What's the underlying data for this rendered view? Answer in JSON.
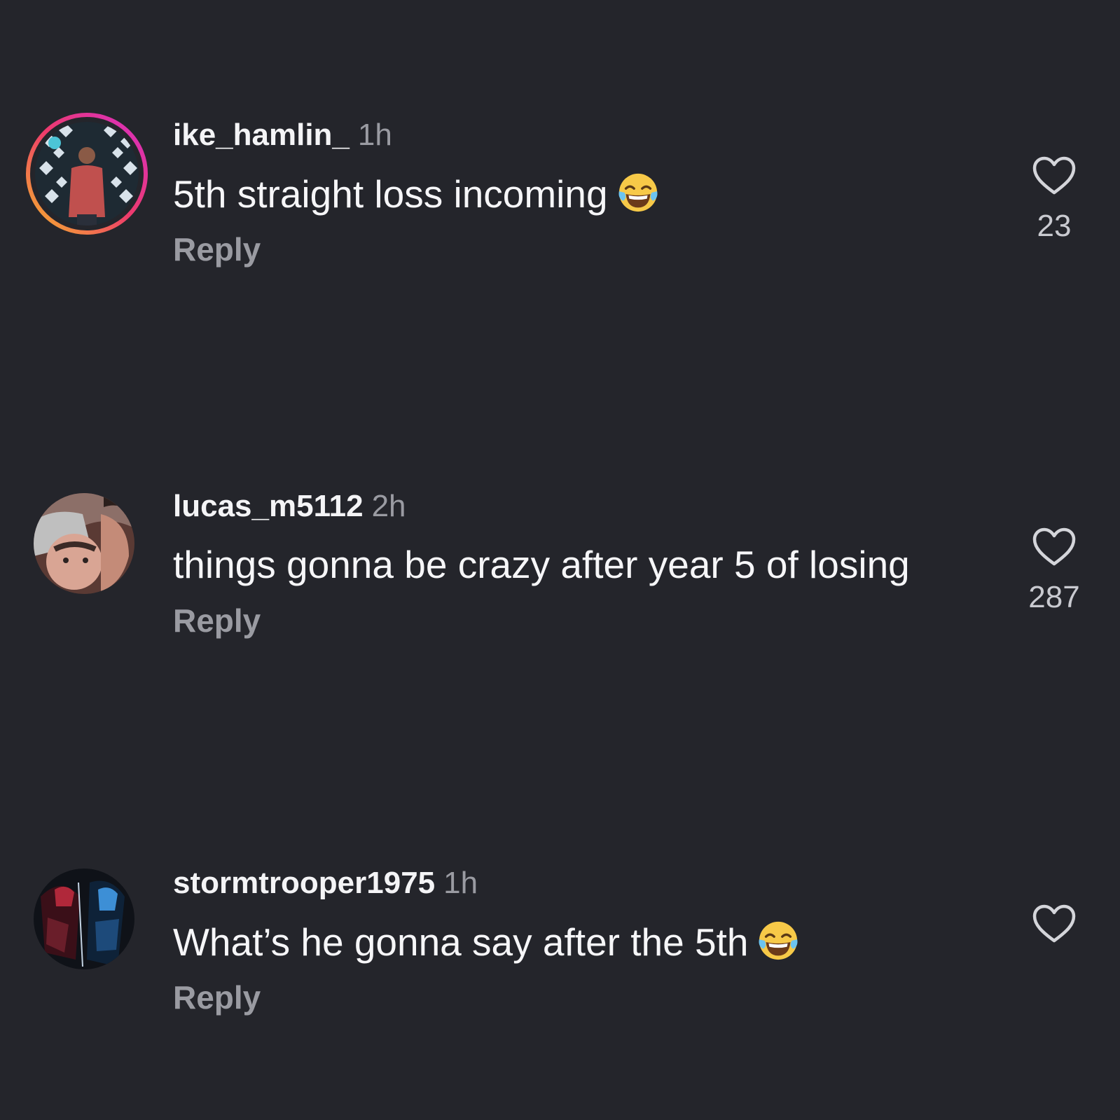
{
  "comments": [
    {
      "username": "ike_hamlin_",
      "time": "1h",
      "text": "5th straight loss incoming",
      "emoji": "face-with-tears-of-joy",
      "reply_label": "Reply",
      "like_count": "23",
      "has_story_ring": true
    },
    {
      "username": "lucas_m5112",
      "time": "2h",
      "text": "things gonna be crazy after year 5 of losing",
      "emoji": "",
      "reply_label": "Reply",
      "like_count": "287",
      "has_story_ring": false
    },
    {
      "username": "stormtrooper1975",
      "time": "1h",
      "text": "What’s he gonna say after the 5th",
      "emoji": "face-with-tears-of-joy",
      "reply_label": "Reply",
      "like_count": "",
      "has_story_ring": false
    }
  ],
  "colors": {
    "background": "#24252b",
    "primary_text": "#f4f4f6",
    "secondary_text": "#9a9ba2",
    "story_ring_start": "#f5b62a",
    "story_ring_end": "#d62ec6"
  },
  "icons": {
    "like": "heart-outline-icon",
    "emoji": "face-with-tears-of-joy"
  }
}
